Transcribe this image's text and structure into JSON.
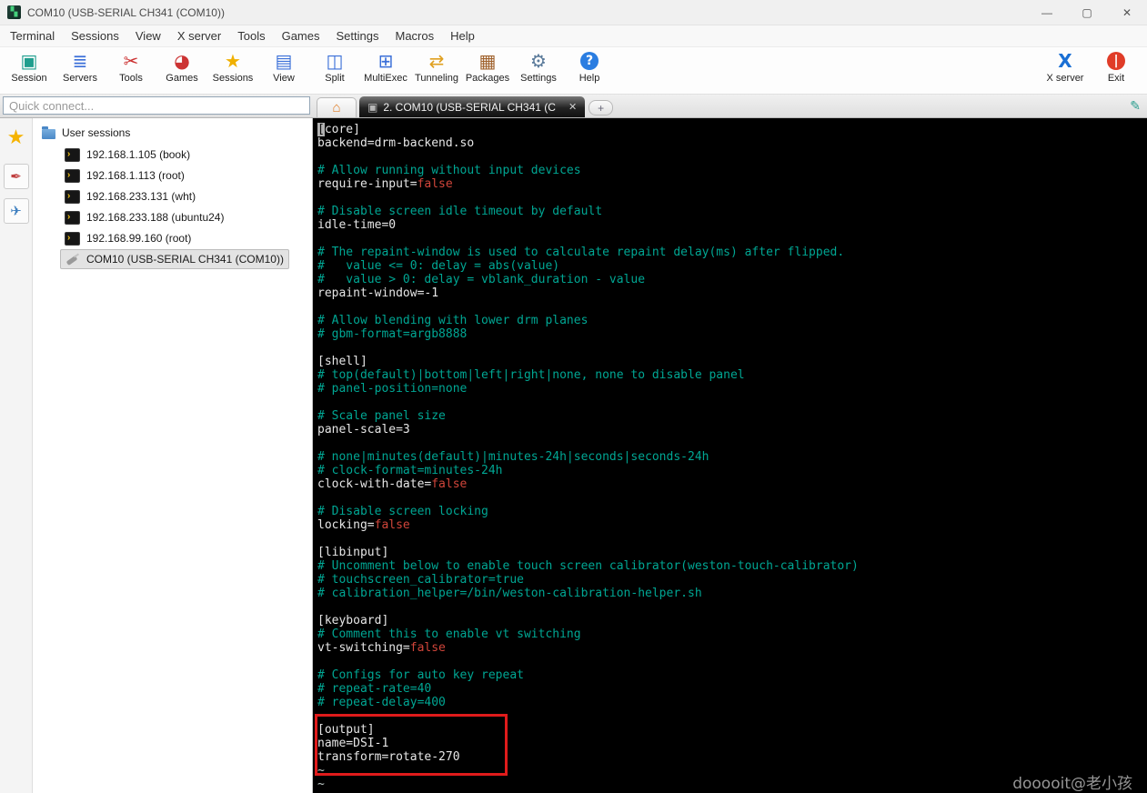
{
  "window": {
    "logo_glyph": "▚",
    "title": "COM10  (USB-SERIAL CH341 (COM10))",
    "minimize": "—",
    "maximize": "▢",
    "close": "✕"
  },
  "menu": {
    "items": [
      "Terminal",
      "Sessions",
      "View",
      "X server",
      "Tools",
      "Games",
      "Settings",
      "Macros",
      "Help"
    ]
  },
  "toolbar": {
    "left": [
      {
        "label": "Session",
        "glyph": "▣",
        "color": "#1f9e8e"
      },
      {
        "label": "Servers",
        "glyph": "≣",
        "color": "#3a6fd8"
      },
      {
        "label": "Tools",
        "glyph": "✂",
        "color": "#cc3333"
      },
      {
        "label": "Games",
        "glyph": "◕",
        "color": "#cc3333"
      },
      {
        "label": "Sessions",
        "glyph": "★",
        "color": "#f0b000"
      },
      {
        "label": "View",
        "glyph": "▤",
        "color": "#3a6fd8"
      },
      {
        "label": "Split",
        "glyph": "◫",
        "color": "#3a6fd8"
      },
      {
        "label": "MultiExec",
        "glyph": "⊞",
        "color": "#3a6fd8"
      },
      {
        "label": "Tunneling",
        "glyph": "⇄",
        "color": "#e0a020"
      },
      {
        "label": "Packages",
        "glyph": "▦",
        "color": "#a0622d"
      },
      {
        "label": "Settings",
        "glyph": "⚙",
        "color": "#5a7a9a"
      },
      {
        "label": "Help",
        "glyph": "?",
        "color": "#ffffff",
        "circle": "#2a7de1"
      }
    ],
    "right": [
      {
        "label": "X server",
        "glyph": "X",
        "color": "#1a6fd4",
        "bold": true
      },
      {
        "label": "Exit",
        "glyph": "|",
        "color": "#ffffff",
        "circle": "#e03c28",
        "bold": true
      }
    ]
  },
  "quick_connect": {
    "placeholder": "Quick connect..."
  },
  "tabs": {
    "home_glyph": "⌂",
    "active": {
      "icon_glyph": "▣",
      "label": "2. COM10  (USB-SERIAL CH341 (C",
      "close": "✕"
    },
    "new_label": "+",
    "pen_glyph": "✎"
  },
  "sidebar": {
    "star_glyph": "★",
    "panel_buttons": [
      {
        "name": "tools-panel",
        "glyph": "✒",
        "color": "#c04040"
      },
      {
        "name": "macros-panel",
        "glyph": "✈",
        "color": "#4080c0"
      }
    ],
    "tree": {
      "root_label": "User sessions",
      "sessions": [
        {
          "label": "192.168.1.105 (book)",
          "type": "ssh"
        },
        {
          "label": "192.168.1.113 (root)",
          "type": "ssh"
        },
        {
          "label": "192.168.233.131 (wht)",
          "type": "ssh"
        },
        {
          "label": "192.168.233.188 (ubuntu24)",
          "type": "ssh"
        },
        {
          "label": "192.168.99.160 (root)",
          "type": "ssh"
        },
        {
          "label": "COM10 (USB-SERIAL CH341 (COM10))",
          "type": "serial",
          "selected": true
        }
      ]
    }
  },
  "terminal": {
    "colors": {
      "fg": "#e6e6e6",
      "comment": "#00a693",
      "val": "#d0453a",
      "tilde": "#bfc9c7",
      "cursor_bg": "#b2b2b2",
      "cursor_fg": "#0a0a0a"
    },
    "lines": [
      [
        [
          "cur",
          "["
        ],
        [
          "fg",
          "core]"
        ]
      ],
      [
        [
          "fg",
          "backend=drm-backend.so"
        ]
      ],
      [],
      [
        [
          "c",
          "# Allow running without input devices"
        ]
      ],
      [
        [
          "fg",
          "require-input="
        ],
        [
          "r",
          "false"
        ]
      ],
      [],
      [
        [
          "c",
          "# Disable screen idle timeout by default"
        ]
      ],
      [
        [
          "fg",
          "idle-time=0"
        ]
      ],
      [],
      [
        [
          "c",
          "# The repaint-window is used to calculate repaint delay(ms) after flipped."
        ]
      ],
      [
        [
          "c",
          "#   value <= 0: delay = abs(value)"
        ]
      ],
      [
        [
          "c",
          "#   value > 0: delay = vblank_duration - value"
        ]
      ],
      [
        [
          "fg",
          "repaint-window=-1"
        ]
      ],
      [],
      [
        [
          "c",
          "# Allow blending with lower drm planes"
        ]
      ],
      [
        [
          "c",
          "# gbm-format=argb8888"
        ]
      ],
      [],
      [
        [
          "fg",
          "[shell]"
        ]
      ],
      [
        [
          "c",
          "# top(default)|bottom|left|right|none, none to disable panel"
        ]
      ],
      [
        [
          "c",
          "# panel-position=none"
        ]
      ],
      [],
      [
        [
          "c",
          "# Scale panel size"
        ]
      ],
      [
        [
          "fg",
          "panel-scale=3"
        ]
      ],
      [],
      [
        [
          "c",
          "# none|minutes(default)|minutes-24h|seconds|seconds-24h"
        ]
      ],
      [
        [
          "c",
          "# clock-format=minutes-24h"
        ]
      ],
      [
        [
          "fg",
          "clock-with-date="
        ],
        [
          "r",
          "false"
        ]
      ],
      [],
      [
        [
          "c",
          "# Disable screen locking"
        ]
      ],
      [
        [
          "fg",
          "locking="
        ],
        [
          "r",
          "false"
        ]
      ],
      [],
      [
        [
          "fg",
          "[libinput]"
        ]
      ],
      [
        [
          "c",
          "# Uncomment below to enable touch screen calibrator(weston-touch-calibrator)"
        ]
      ],
      [
        [
          "c",
          "# touchscreen_calibrator=true"
        ]
      ],
      [
        [
          "c",
          "# calibration_helper=/bin/weston-calibration-helper.sh"
        ]
      ],
      [],
      [
        [
          "fg",
          "[keyboard]"
        ]
      ],
      [
        [
          "c",
          "# Comment this to enable vt switching"
        ]
      ],
      [
        [
          "fg",
          "vt-switching="
        ],
        [
          "r",
          "false"
        ]
      ],
      [],
      [
        [
          "c",
          "# Configs for auto key repeat"
        ]
      ],
      [
        [
          "c",
          "# repeat-rate=40"
        ]
      ],
      [
        [
          "c",
          "# repeat-delay=400"
        ]
      ],
      [],
      [
        [
          "fg",
          "[output]"
        ]
      ],
      [
        [
          "fg",
          "name=DSI-1"
        ]
      ],
      [
        [
          "fg",
          "transform=rotate-270"
        ]
      ],
      [
        [
          "t",
          "~"
        ]
      ],
      [
        [
          "t",
          "~"
        ]
      ]
    ],
    "watermark": "dooooit@老小孩"
  },
  "annotation": {
    "color": "#e01b1b"
  }
}
